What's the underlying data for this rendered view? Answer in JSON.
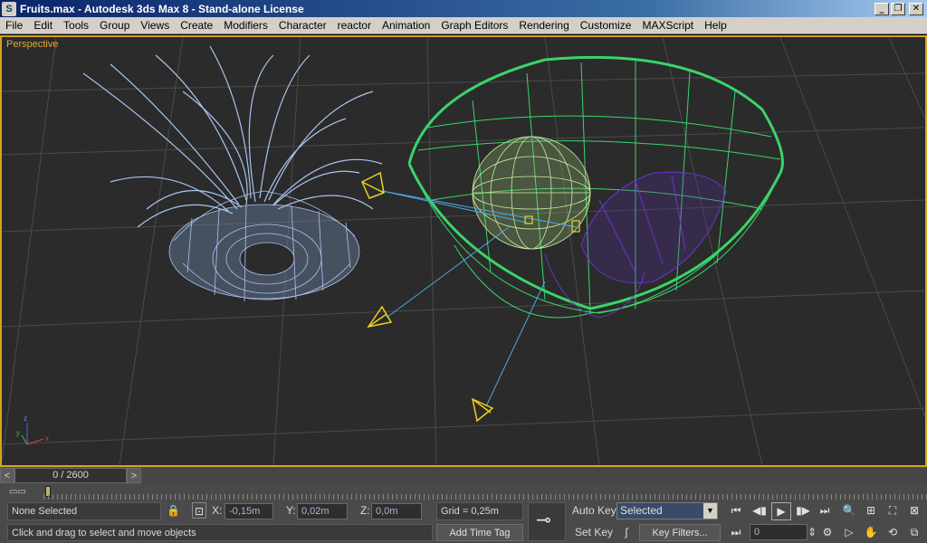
{
  "window": {
    "title": "Fruits.max - Autodesk 3ds Max 8  - Stand-alone License",
    "icon_label": "S",
    "minimize_glyph": "_",
    "maximize_glyph": "❐",
    "close_glyph": "✕"
  },
  "menu": [
    "File",
    "Edit",
    "Tools",
    "Group",
    "Views",
    "Create",
    "Modifiers",
    "Character",
    "reactor",
    "Animation",
    "Graph Editors",
    "Rendering",
    "Customize",
    "MAXScript",
    "Help"
  ],
  "viewport": {
    "label": "Perspective",
    "border_color": "#d6a21e",
    "background_color": "#2b2b2b",
    "axis_x_label": "x",
    "axis_y_label": "y",
    "axis_z_label": "z"
  },
  "timeline": {
    "prev_glyph": "<",
    "next_glyph": ">",
    "frame_readout": "0 / 2600"
  },
  "status": {
    "selection_text": "None Selected",
    "prompt_text": "Click and drag to select and move objects",
    "x_label": "X:",
    "x_value": "-0,15m",
    "y_label": "Y:",
    "y_value": "0,02m",
    "z_label": "Z:",
    "z_value": "0,0m",
    "grid_text": "Grid = 0,25m",
    "add_time_tag": "Add Time Tag",
    "auto_key": "Auto Key",
    "set_key": "Set Key",
    "key_mode_selected": "Selected",
    "key_filters": "Key Filters...",
    "current_frame": "0"
  },
  "colors": {
    "vase": "#a8c4f0",
    "bowl": "#3bd46a",
    "apple": "#c8f0a0",
    "plum": "#6a34c8",
    "camera": "#f0d020",
    "target_line": "#4aa8e0",
    "grid": "#4a4a4a"
  }
}
